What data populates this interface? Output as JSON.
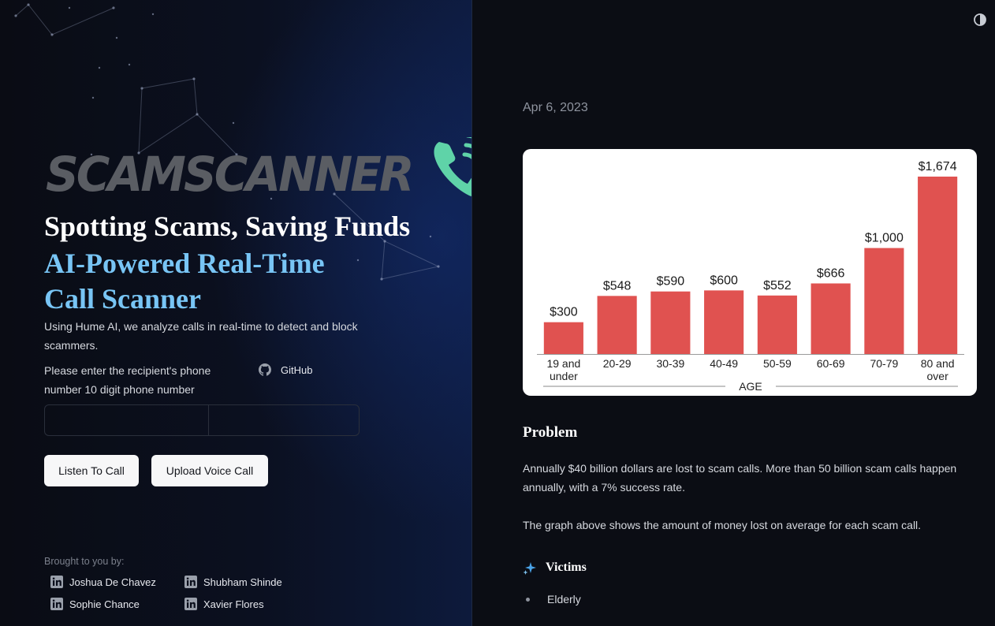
{
  "brand": {
    "logo_text": "SCAMSCANNER",
    "phone_icon": "phone-ringing-icon",
    "logo_color": "#5a5d63",
    "phone_color": "#5fd3a8"
  },
  "hero": {
    "tagline": "Spotting Scams, Saving Funds",
    "headline_line1": "AI-Powered Real-Time",
    "headline_line2": "Call Scanner",
    "description": "Using Hume AI, we analyze calls in real-time to detect and block scammers.",
    "accent_color": "#78c5f5"
  },
  "form": {
    "prompt": "Please enter the recipient's phone number 10 digit phone number",
    "github_label": "GitHub",
    "digit_count": 10,
    "listen_label": "Listen To Call",
    "upload_label": "Upload Voice Call"
  },
  "credits": {
    "heading": "Brought to you by:",
    "members": [
      {
        "name": "Joshua De Chavez",
        "icon": "linkedin-icon"
      },
      {
        "name": "Shubham Shinde",
        "icon": "linkedin-icon"
      },
      {
        "name": "Sophie Chance",
        "icon": "linkedin-icon"
      },
      {
        "name": "Xavier Flores",
        "icon": "linkedin-icon"
      }
    ]
  },
  "article": {
    "date": "Apr 6, 2023",
    "problem_heading": "Problem",
    "paragraph1": "Annually $40 billion dollars are lost to scam calls. More than 50 billion scam calls happen annually, with a 7% success rate.",
    "paragraph2": "The graph above shows the amount of money lost on average for each scam call.",
    "victims_heading": "Victims",
    "victims_icon": "sparkle-icon",
    "victims": [
      "Elderly"
    ],
    "theme_icon": "contrast-toggle-icon"
  },
  "chart_data": {
    "type": "bar",
    "categories": [
      "19 and under",
      "20-29",
      "30-39",
      "40-49",
      "50-59",
      "60-69",
      "70-79",
      "80 and over"
    ],
    "category_lines": [
      [
        "19 and",
        "under"
      ],
      [
        "20-29"
      ],
      [
        "30-39"
      ],
      [
        "40-49"
      ],
      [
        "50-59"
      ],
      [
        "60-69"
      ],
      [
        "70-79"
      ],
      [
        "80 and",
        "over"
      ]
    ],
    "values": [
      300,
      548,
      590,
      600,
      552,
      666,
      1000,
      1674
    ],
    "value_labels": [
      "$300",
      "$548",
      "$590",
      "$600",
      "$552",
      "$666",
      "$1,000",
      "$1,674"
    ],
    "xlabel": "AGE",
    "ylabel": "",
    "title": "",
    "ylim": [
      0,
      1674
    ],
    "bar_color": "#e05250",
    "grid": false
  }
}
